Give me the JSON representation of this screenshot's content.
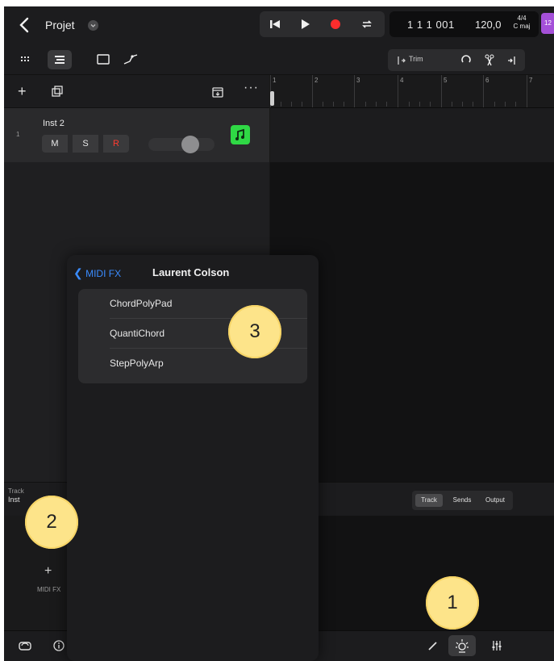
{
  "app": {
    "project_title": "Projet",
    "lcd_position": "1 1 1 001",
    "lcd_tempo": "120,0",
    "lcd_time_signature": "4/4",
    "lcd_key": "C maj",
    "badge": "12",
    "accent_color": "#3a8cff",
    "record_color": "#ff2d2d",
    "instrument_color": "#2fd845"
  },
  "toolbar": {
    "trim_label": "Trim"
  },
  "track": {
    "number": "1",
    "name": "Inst 2",
    "mute_label": "M",
    "solo_label": "S",
    "record_label": "R",
    "instrument_icon": "music-note-icon"
  },
  "ruler": {
    "bars": [
      "1",
      "2",
      "3",
      "4",
      "5",
      "6",
      "7"
    ]
  },
  "inspector": {
    "track_label": "Track",
    "track_name_partial": "Inst",
    "tabs": [
      "Track",
      "Sends",
      "Output"
    ],
    "midi_fx_plus": "+",
    "midi_fx_label": "MIDI FX"
  },
  "popover": {
    "back_label": "MIDI FX",
    "title": "Laurent Colson",
    "items": [
      "ChordPolyPad",
      "QuantiChord",
      "StepPolyArp"
    ]
  },
  "callouts": [
    "1",
    "2",
    "3"
  ]
}
